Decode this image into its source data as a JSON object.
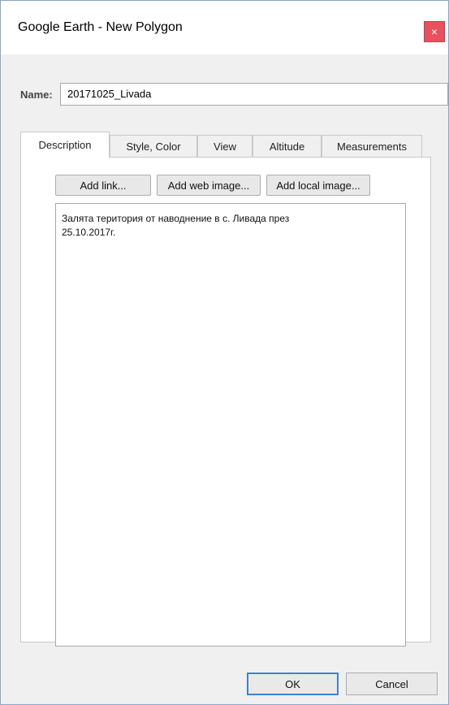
{
  "window": {
    "title": "Google Earth - New Polygon",
    "close_glyph": "×"
  },
  "name": {
    "label": "Name:",
    "value": "20171025_Livada"
  },
  "tabs": [
    {
      "label": "Description",
      "active": true
    },
    {
      "label": "Style, Color",
      "active": false
    },
    {
      "label": "View",
      "active": false
    },
    {
      "label": "Altitude",
      "active": false
    },
    {
      "label": "Measurements",
      "active": false
    }
  ],
  "description_panel": {
    "add_link_label": "Add link...",
    "add_web_image_label": "Add web image...",
    "add_local_image_label": "Add local image...",
    "text": "Залята територия от наводнение в с. Ливада през\n25.10.2017г."
  },
  "footer": {
    "ok_label": "OK",
    "cancel_label": "Cancel"
  },
  "colors": {
    "close_button": "#e8515d",
    "default_button_border": "#3c83d6"
  }
}
